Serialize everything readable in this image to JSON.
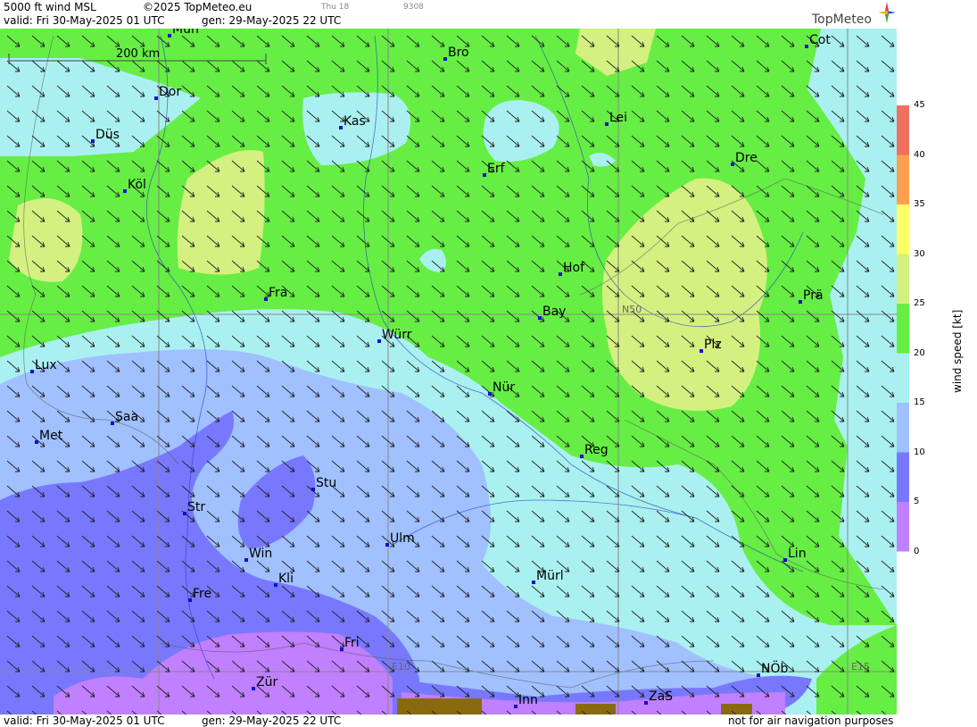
{
  "header": {
    "title": "5000 ft wind MSL",
    "copyright": "©2025 TopMeteo.eu",
    "valid": "valid:  Fri  30-May-2025  01 UTC",
    "gen": "gen: 29-May-2025 22 UTC",
    "small_a": "Thu 18",
    "small_b": "9308",
    "logo": "TopMeteo"
  },
  "footer": {
    "valid": "valid:  Fri  30-May-2025  01 UTC",
    "gen": "gen: 29-May-2025 22 UTC",
    "disclaimer": "not for air navigation purposes"
  },
  "scale_label": "200 km",
  "grid_labels": [
    "N50",
    "E10",
    "E15"
  ],
  "cities": [
    "Mün",
    "Bro",
    "Cot",
    "Dor",
    "Kas",
    "Lei",
    "Düs",
    "Erf",
    "Dre",
    "Köl",
    "Hof",
    "Fra",
    "Bay",
    "Prä",
    "Würr",
    "Plz",
    "Lux",
    "Nür",
    "Saa",
    "Met",
    "Reg",
    "Stu",
    "Str",
    "Ulm",
    "Win",
    "Kli",
    "Lin",
    "Mürl",
    "Fre",
    "Fri",
    "NÖb",
    "Zür",
    "ZaS",
    "Inn"
  ],
  "colorbar": {
    "title": "wind speed [kt]",
    "ticks": [
      "45",
      "40",
      "35",
      "30",
      "25",
      "20",
      "15",
      "10",
      "5",
      "0"
    ],
    "colors": [
      "#f07060",
      "#ffa050",
      "#ffff66",
      "#d4f080",
      "#66ee44",
      "#aaf0f0",
      "#a0c0ff",
      "#7878ff",
      "#c080ff"
    ]
  }
}
